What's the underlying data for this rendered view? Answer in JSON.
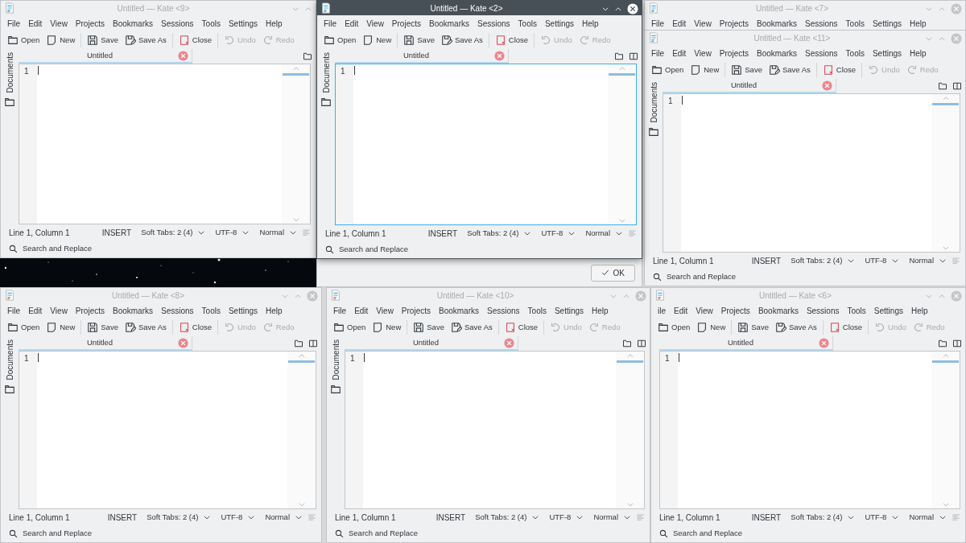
{
  "windows": [
    {
      "title": "Untitled — Kate <9>",
      "active": false,
      "menu": [
        "File",
        "Edit",
        "View",
        "Projects",
        "Bookmarks",
        "Sessions",
        "Tools",
        "Settings",
        "Help"
      ],
      "toolbar": [
        [
          {
            "label": "Open",
            "kind": "open",
            "disabled": false
          },
          {
            "label": "New",
            "kind": "new",
            "disabled": false
          }
        ],
        [
          {
            "label": "Save",
            "kind": "save",
            "disabled": false
          },
          {
            "label": "Save As",
            "kind": "saveas",
            "disabled": false
          }
        ],
        [
          {
            "label": "Close",
            "kind": "close",
            "disabled": false
          }
        ],
        [
          {
            "label": "Undo",
            "kind": "undo",
            "disabled": true
          },
          {
            "label": "Redo",
            "kind": "redo",
            "disabled": true
          }
        ]
      ],
      "sidebar_label": "Documents",
      "tab": "Untitled",
      "line_number": "1",
      "status": {
        "position": "Line 1, Column 1",
        "mode": "INSERT",
        "indent": "Soft Tabs: 2 (4)",
        "encoding": "UTF-8",
        "syntax": "Normal"
      },
      "search": "Search and Replace"
    },
    {
      "title": "Untitled — Kate <2>",
      "active": true,
      "menu": [
        "File",
        "Edit",
        "View",
        "Projects",
        "Bookmarks",
        "Sessions",
        "Tools",
        "Settings",
        "Help"
      ],
      "toolbar": [
        [
          {
            "label": "Open",
            "kind": "open",
            "disabled": false
          },
          {
            "label": "New",
            "kind": "new",
            "disabled": false
          }
        ],
        [
          {
            "label": "Save",
            "kind": "save",
            "disabled": false
          },
          {
            "label": "Save As",
            "kind": "saveas",
            "disabled": false
          }
        ],
        [
          {
            "label": "Close",
            "kind": "close",
            "disabled": false
          }
        ],
        [
          {
            "label": "Undo",
            "kind": "undo",
            "disabled": true
          },
          {
            "label": "Redo",
            "kind": "redo",
            "disabled": true
          }
        ]
      ],
      "sidebar_label": "Documents",
      "tab": "Untitled",
      "line_number": "1",
      "status": {
        "position": "Line 1, Column 1",
        "mode": "INSERT",
        "indent": "Soft Tabs: 2 (4)",
        "encoding": "UTF-8",
        "syntax": "Normal"
      },
      "search": "Search and Replace"
    },
    {
      "title": "Untitled — Kate <7>",
      "active": false,
      "menu": [
        "File",
        "Edit",
        "View",
        "Projects",
        "Bookmarks",
        "Sessions",
        "Tools",
        "Settings",
        "Help"
      ]
    },
    {
      "title": "Untitled — Kate <11>",
      "active": false,
      "menu": [
        "File",
        "Edit",
        "View",
        "Projects",
        "Bookmarks",
        "Sessions",
        "Tools",
        "Settings",
        "Help"
      ],
      "toolbar": [
        [
          {
            "label": "Open",
            "kind": "open",
            "disabled": false
          },
          {
            "label": "New",
            "kind": "new",
            "disabled": false
          }
        ],
        [
          {
            "label": "Save",
            "kind": "save",
            "disabled": false
          },
          {
            "label": "Save As",
            "kind": "saveas",
            "disabled": false
          }
        ],
        [
          {
            "label": "Close",
            "kind": "close",
            "disabled": false
          }
        ],
        [
          {
            "label": "Undo",
            "kind": "undo",
            "disabled": true
          },
          {
            "label": "Redo",
            "kind": "redo",
            "disabled": true
          }
        ]
      ],
      "sidebar_label": "Documents",
      "tab": "Untitled",
      "line_number": "1",
      "status": {
        "position": "Line 1, Column 1",
        "mode": "INSERT",
        "indent": "Soft Tabs: 2 (4)",
        "encoding": "UTF-8",
        "syntax": "Normal"
      },
      "search": "Search and Replace"
    },
    {
      "title": "Untitled — Kate <8>",
      "active": false,
      "menu": [
        "File",
        "Edit",
        "View",
        "Projects",
        "Bookmarks",
        "Sessions",
        "Tools",
        "Settings",
        "Help"
      ],
      "toolbar": [
        [
          {
            "label": "Open",
            "kind": "open",
            "disabled": false
          },
          {
            "label": "New",
            "kind": "new",
            "disabled": false
          }
        ],
        [
          {
            "label": "Save",
            "kind": "save",
            "disabled": false
          },
          {
            "label": "Save As",
            "kind": "saveas",
            "disabled": false
          }
        ],
        [
          {
            "label": "Close",
            "kind": "close",
            "disabled": false
          }
        ],
        [
          {
            "label": "Undo",
            "kind": "undo",
            "disabled": true
          },
          {
            "label": "Redo",
            "kind": "redo",
            "disabled": true
          }
        ]
      ],
      "sidebar_label": "Documents",
      "tab": "Untitled",
      "line_number": "1",
      "status": {
        "position": "Line 1, Column 1",
        "mode": "INSERT",
        "indent": "Soft Tabs: 2 (4)",
        "encoding": "UTF-8",
        "syntax": "Normal"
      },
      "search": "Search and Replace"
    },
    {
      "title": "Untitled — Kate <10>",
      "active": false,
      "menu": [
        "File",
        "Edit",
        "View",
        "Projects",
        "Bookmarks",
        "Sessions",
        "Tools",
        "Settings",
        "Help"
      ],
      "toolbar": [
        [
          {
            "label": "Open",
            "kind": "open",
            "disabled": false
          },
          {
            "label": "New",
            "kind": "new",
            "disabled": false
          }
        ],
        [
          {
            "label": "Save",
            "kind": "save",
            "disabled": false
          },
          {
            "label": "Save As",
            "kind": "saveas",
            "disabled": false
          }
        ],
        [
          {
            "label": "Close",
            "kind": "close",
            "disabled": false
          }
        ],
        [
          {
            "label": "Undo",
            "kind": "undo",
            "disabled": true
          },
          {
            "label": "Redo",
            "kind": "redo",
            "disabled": true
          }
        ]
      ],
      "sidebar_label": "Documents",
      "tab": "Untitled",
      "line_number": "1",
      "status": {
        "position": "Line 1, Column 1",
        "mode": "INSERT",
        "indent": "Soft Tabs: 2 (4)",
        "encoding": "UTF-8",
        "syntax": "Normal"
      },
      "search": "Search and Replace"
    },
    {
      "title": "Untitled — Kate <6>",
      "active": false,
      "menu": [
        "ile",
        "Edit",
        "View",
        "Projects",
        "Bookmarks",
        "Sessions",
        "Tools",
        "Settings",
        "Help"
      ],
      "toolbar": [
        [
          {
            "label": "Open",
            "kind": "open",
            "disabled": false
          },
          {
            "label": "New",
            "kind": "new",
            "disabled": false
          }
        ],
        [
          {
            "label": "Save",
            "kind": "save",
            "disabled": false
          },
          {
            "label": "Save As",
            "kind": "saveas",
            "disabled": false
          }
        ],
        [
          {
            "label": "Close",
            "kind": "close",
            "disabled": false
          }
        ],
        [
          {
            "label": "Undo",
            "kind": "undo",
            "disabled": true
          },
          {
            "label": "Redo",
            "kind": "redo",
            "disabled": true
          }
        ]
      ],
      "tab": "Untitled",
      "line_number": "1",
      "status": {
        "position": "Line 1, Column 1",
        "mode": "INSERT",
        "indent": "Soft Tabs: 2 (4)",
        "encoding": "UTF-8",
        "syntax": "Normal"
      },
      "search": "Search and Replace"
    }
  ],
  "dialog": {
    "button": "OK"
  }
}
